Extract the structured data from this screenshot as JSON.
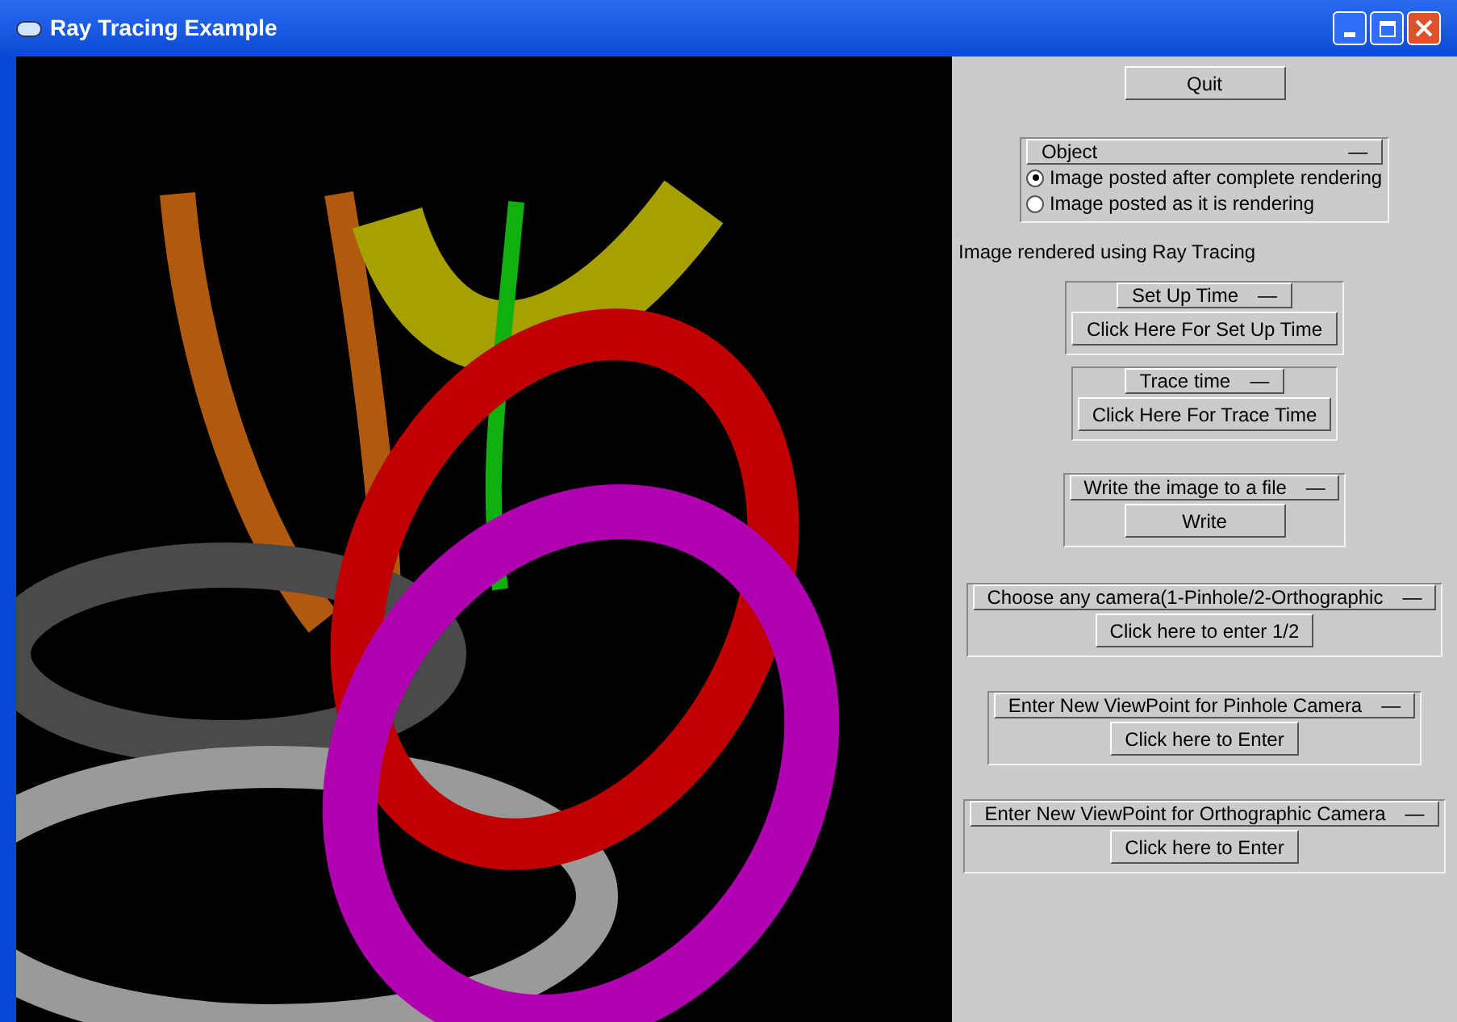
{
  "window": {
    "title": "Ray Tracing Example"
  },
  "panel": [
    {
      "kind": "button",
      "label": "Quit"
    },
    {
      "kind": "radio_group",
      "title": "Object",
      "toggle": "—",
      "options": [
        {
          "label": "Image posted after complete rendering",
          "selected": true
        },
        {
          "label": "Image posted as it is rendering",
          "selected": false
        }
      ]
    },
    {
      "kind": "label",
      "text": "Image rendered using Ray Tracing"
    },
    {
      "kind": "button_group",
      "title": "Set Up Time",
      "toggle": "—",
      "button": "Click Here For Set Up Time"
    },
    {
      "kind": "button_group",
      "title": "Trace time",
      "toggle": "—",
      "button": "Click Here For Trace Time"
    },
    {
      "kind": "button_group",
      "title": "Write the image to a file",
      "toggle": "—",
      "button": "Write"
    },
    {
      "kind": "button_group",
      "title": "Choose any camera(1-Pinhole/2-Orthographic",
      "toggle": "—",
      "button": "Click here to enter 1/2"
    },
    {
      "kind": "button_group",
      "title": "Enter New ViewPoint for Pinhole Camera",
      "toggle": "—",
      "button": "Click here to Enter"
    },
    {
      "kind": "button_group",
      "title": "Enter New ViewPoint for Orthographic Camera",
      "toggle": "—",
      "button": "Click here to Enter"
    }
  ]
}
